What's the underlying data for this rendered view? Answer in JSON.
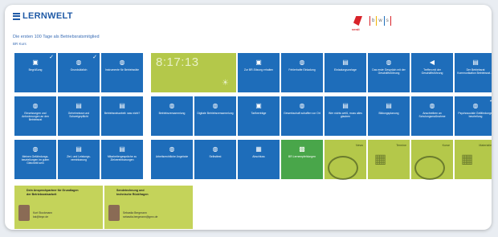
{
  "header": {
    "logo_text": "LERNWELT",
    "subtitle": "Die ersten 100 Tage als Betriebsratsmitglied",
    "subsub": "BR Kurs",
    "verdi_label": "verdi",
    "bws": [
      "b",
      "w",
      "s"
    ]
  },
  "clock": {
    "time": "8:17:13",
    "sun_icon": "sun-icon"
  },
  "tiles": [
    {
      "id": "begruessung",
      "label": "Begrüßung",
      "icon": "screen-icon",
      "checked": true
    },
    {
      "id": "grundsaetzlich",
      "label": "Grundsätzlich",
      "icon": "globe-icon",
      "checked": true
    },
    {
      "id": "instrumente",
      "label": "Instrumente für Betriebsräte",
      "icon": "globe-icon",
      "checked": false
    },
    {
      "id": "zur-br-sitzung",
      "label": "Zur BR-Sitzung erhalten",
      "icon": "screen-icon",
      "checked": false
    },
    {
      "id": "fehlerhafte-einladung",
      "label": "Fehlerhafte Einladung",
      "icon": "globe-icon",
      "checked": false
    },
    {
      "id": "einladungsvorlage",
      "label": "Einladungsvorlage",
      "icon": "doc-icon",
      "checked": false
    },
    {
      "id": "erstes-gespraech",
      "label": "Das erste Gespräch mit der Geschäftsführung",
      "icon": "globe-icon",
      "checked": false
    },
    {
      "id": "treffen",
      "label": "Treffen mit der Geschäftsführung",
      "icon": "speaker-icon",
      "checked": false
    },
    {
      "id": "betriebsrat-kommunikation",
      "label": "Der Betriebsrat Kommunikation Betriebsrat...?",
      "icon": "doc-icon",
      "checked": false
    },
    {
      "id": "einsetzungen",
      "label": "Einsetzungen und Anforderungen an den Betriebsrat",
      "icon": "globe-icon",
      "checked": false
    },
    {
      "id": "geheimnisse",
      "label": "Geheimnisse und Schweigepflicht",
      "icon": "doc-icon",
      "checked": false
    },
    {
      "id": "betriebsratsarbeit",
      "label": "Betriebsratsarbeit: was nicht?",
      "icon": "doc-icon",
      "checked": false
    },
    {
      "id": "betriebsversammlung",
      "label": "Betriebsversammlung",
      "icon": "globe-icon",
      "checked": false
    },
    {
      "id": "digitale-betriebsversammlung",
      "label": "Digitale Betriebsversammlung",
      "icon": "globe-icon",
      "checked": false
    },
    {
      "id": "tarifvertraege",
      "label": "Tarifverträge",
      "icon": "screen-icon",
      "checked": false
    },
    {
      "id": "gewerkschaft",
      "label": "Gewerkschaft schaffen vor Ort",
      "icon": "globe-icon",
      "checked": false
    },
    {
      "id": "wer-nichts-weiss",
      "label": "Wer nichts weiß, muss alles glauben",
      "icon": "doc-icon",
      "checked": false
    },
    {
      "id": "bildungsplanung",
      "label": "Bildungsplanung",
      "icon": "doc-icon",
      "checked": false
    },
    {
      "id": "anschreiben",
      "label": "Anschreiben an Schulungsmaßnahme",
      "icon": "globe-icon",
      "checked": false
    },
    {
      "id": "psychosoziale",
      "label": "Psychosoziale Gefährdungs-beurteilung",
      "icon": "globe-icon",
      "checked": true
    },
    {
      "id": "meine-gefaehrdungs",
      "label": "Meinen Gefährdungs-beurteilungen im guten Gleichtritt sein",
      "icon": "globe-icon",
      "checked": false
    },
    {
      "id": "ziel-und-leistungs",
      "label": "Ziel- und Leistungs-vereinbarung",
      "icon": "doc-icon",
      "checked": false
    },
    {
      "id": "mitarbeitergespraeche",
      "label": "Mitarbeitergespräche zu Zielvereinbarungen",
      "icon": "doc-icon",
      "checked": false
    },
    {
      "id": "arbeitsrechtliche",
      "label": "Arbeitsrechtliche Angebote",
      "icon": "globe-icon",
      "checked": false
    },
    {
      "id": "selbsttest",
      "label": "Selbsttest",
      "icon": "globe-icon",
      "checked": false
    },
    {
      "id": "abschluss",
      "label": "Abschluss",
      "icon": "group-icon",
      "checked": false
    },
    {
      "id": "br-lernempfehlungen",
      "label": "BR Lernempfehlungen",
      "icon": "picture-icon",
      "checked": false
    }
  ],
  "green_tiles": [
    {
      "id": "news",
      "label": "News"
    },
    {
      "id": "termine",
      "label": "Termine"
    },
    {
      "id": "kurse",
      "label": "Kurse"
    },
    {
      "id": "materialien",
      "label": "Materialien"
    }
  ],
  "contacts": [
    {
      "title1": "Dein Ansprechpartner für Grundlagen",
      "title2": "der Betriebsratsarbeit",
      "name": "Kurt Stockmann",
      "email": "kst@bnpr.de"
    },
    {
      "title1": "Sendetechnung und",
      "title2": "technische Rückfragen",
      "name": "Sebastia Bergmann",
      "email": "sebastia.bergmann@gmx.de"
    }
  ]
}
